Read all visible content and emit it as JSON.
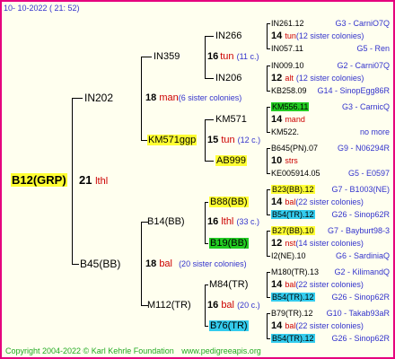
{
  "header_date": "10- 10-2022 ( 21: 52)",
  "footer": {
    "copyright": "Copyright 2004-2022 © Karl Kehrle Foundation",
    "site": "www.pedigreeapis.org"
  },
  "root": {
    "name": "B12(GRP)",
    "year": "21",
    "breeder": "lthl"
  },
  "gen1": [
    {
      "name": "IN202",
      "year": "18",
      "breeder": "man",
      "sisters": "(6 sister colonies)"
    },
    {
      "name": "B45(BB)",
      "year": "18",
      "breeder": "bal",
      "sisters": "(20 sister colonies)"
    }
  ],
  "gen2": [
    {
      "name": "IN359",
      "year": "16",
      "breeder": "tun",
      "sisters": "(11 c.)"
    },
    {
      "name": "KM571ggp",
      "year": "15",
      "breeder": "tun",
      "sisters": "(12 c.)"
    },
    {
      "name": "B14(BB)",
      "year": "16",
      "breeder": "lthl",
      "sisters": "(33 c.)"
    },
    {
      "name": "M112(TR)",
      "year": "16",
      "breeder": "bal",
      "sisters": "(20 c.)"
    }
  ],
  "gen3": [
    {
      "name": "IN266"
    },
    {
      "name": "IN206"
    },
    {
      "name": "KM571"
    },
    {
      "name": "AB999"
    },
    {
      "name": "B88(BB)"
    },
    {
      "name": "B19(BB)"
    },
    {
      "name": "M84(TR)"
    },
    {
      "name": "B76(TR)"
    }
  ],
  "gen4": [
    {
      "top": "IN261.12",
      "topnote": "G3 - CarniO7Q",
      "year": "14",
      "breeder": "tun",
      "sisters": "(12 sister colonies)",
      "bottom": "IN057.11",
      "bottomnote": "G5 - Ren"
    },
    {
      "top": "IN009.10",
      "topnote": "G2 - Carni07Q",
      "year": "12",
      "breeder": "alt",
      "sisters": "(12 sister colonies)",
      "bottom": "KB258.09",
      "bottomnote": "G14 - SinopEgg86R"
    },
    {
      "top": "KM556.11",
      "topnote": "G3 - CarnicQ",
      "year": "14",
      "breeder": "mand",
      "sisters": "",
      "bottom": "KM522.",
      "bottomnote": "no more"
    },
    {
      "top": "B645(PN).07",
      "topnote": "G9 - N06294R",
      "year": "10",
      "breeder": "strs",
      "sisters": "",
      "bottom": "KE005914.05",
      "bottomnote": "G5 - E0597"
    },
    {
      "top": "B23(BB).12",
      "topnote": "G7 - B1003(NE)",
      "year": "14",
      "breeder": "bal",
      "sisters": "(22 sister colonies)",
      "bottom": "B54(TR).12",
      "bottomnote": "G26 - Sinop62R"
    },
    {
      "top": "B27(BB).10",
      "topnote": "G7 - Bayburt98-3",
      "year": "12",
      "breeder": "nst",
      "sisters": "(14 sister colonies)",
      "bottom": "I2(NE).10",
      "bottomnote": "G6 - SardiniaQ"
    },
    {
      "top": "M180(TR).13",
      "topnote": "G2 - KilimandQ",
      "year": "14",
      "breeder": "bal",
      "sisters": "(22 sister colonies)",
      "bottom": "B54(TR).12",
      "bottomnote": "G26 - Sinop62R"
    },
    {
      "top": "B79(TR).12",
      "topnote": "G10 - Takab93aR",
      "year": "14",
      "breeder": "bal",
      "sisters": "(22 sister colonies)",
      "bottom": "B54(TR).12",
      "bottomnote": "G26 - Sinop62R"
    }
  ],
  "colors": {
    "border": "#e6007e",
    "background": "#ffffef",
    "breeder": "#cc0000",
    "sisters": "#3333cc",
    "yellow": "#ffff33",
    "green": "#22cc22",
    "cyan": "#33ccee",
    "footer": "#22aa22"
  }
}
